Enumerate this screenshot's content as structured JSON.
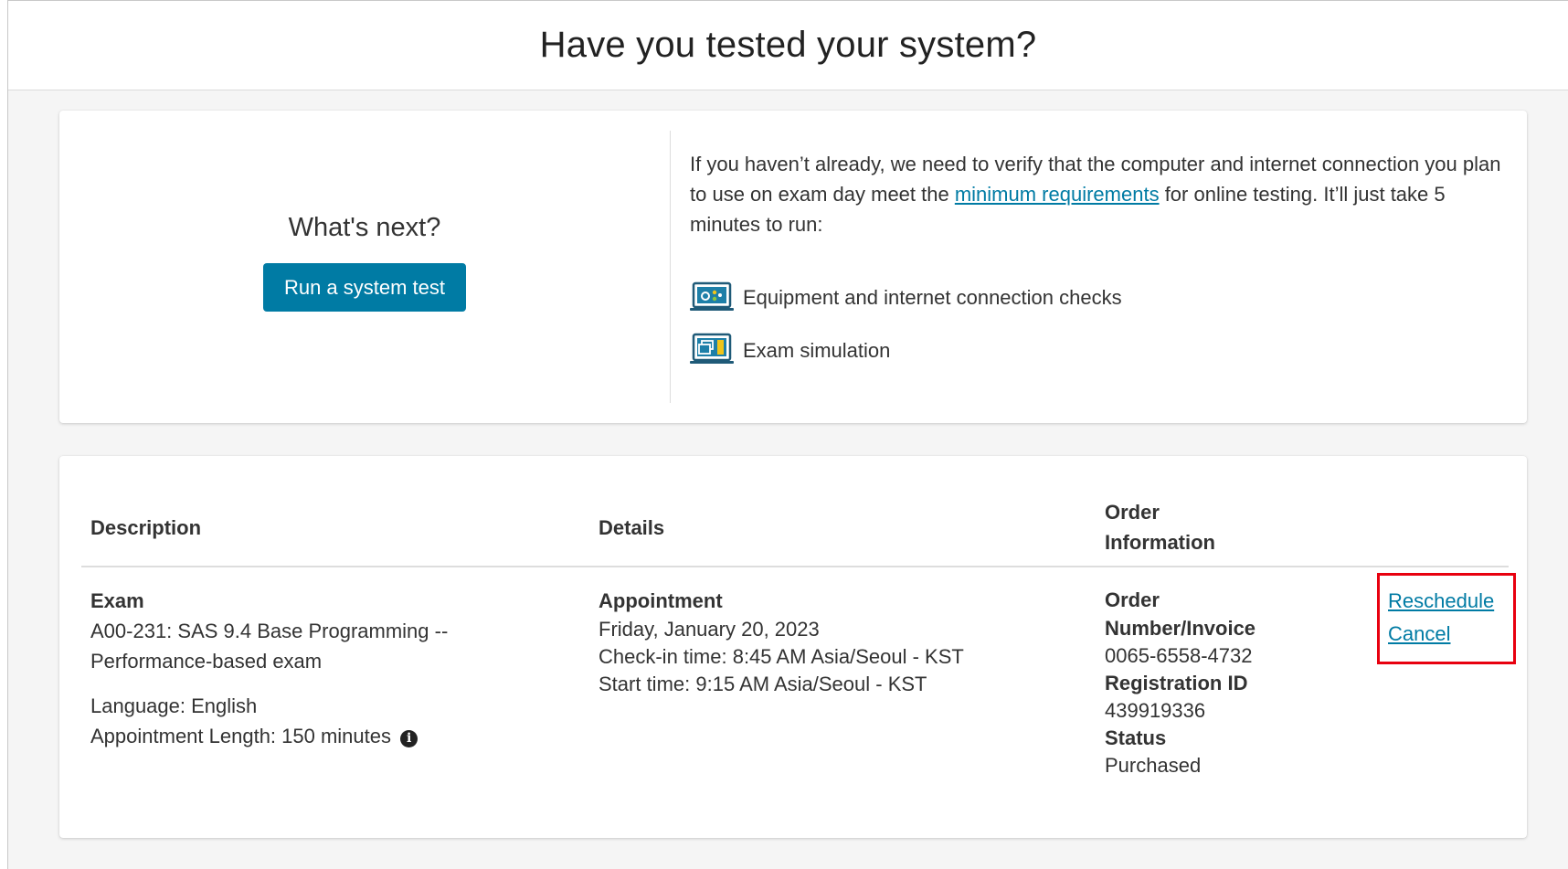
{
  "header": {
    "title": "Have you tested your system?"
  },
  "next": {
    "heading": "What's next?",
    "button_label": "Run a system test"
  },
  "info": {
    "text_before_link": "If you haven’t already, we need to verify that the computer and internet connection you plan to use on exam day meet the ",
    "link_text": "minimum requirements",
    "text_after_link": " for online testing. It’ll just take 5 minutes to run:",
    "checks": [
      {
        "icon": "equipment-check-icon",
        "label": "Equipment and internet connection checks"
      },
      {
        "icon": "exam-simulation-icon",
        "label": "Exam simulation"
      }
    ]
  },
  "table": {
    "headers": {
      "description": "Description",
      "details": "Details",
      "order_info": "Order Information"
    },
    "row": {
      "exam_label": "Exam",
      "exam_name": "A00-231: SAS 9.4 Base Programming -- Performance-based exam",
      "language": "Language: English",
      "length": "Appointment Length: 150 minutes",
      "appointment_label": "Appointment",
      "date": "Friday, January 20, 2023",
      "checkin": "Check-in time: 8:45 AM Asia/Seoul - KST",
      "start": "Start time: 9:15 AM Asia/Seoul - KST",
      "order_number_label": "Order Number/Invoice",
      "order_number": "0065-6558-4732",
      "registration_label": "Registration ID",
      "registration_id": "439919336",
      "status_label": "Status",
      "status": "Purchased",
      "reschedule": "Reschedule",
      "cancel": "Cancel"
    }
  },
  "colors": {
    "accent": "#007ba4",
    "highlight_border": "#e8000f"
  }
}
